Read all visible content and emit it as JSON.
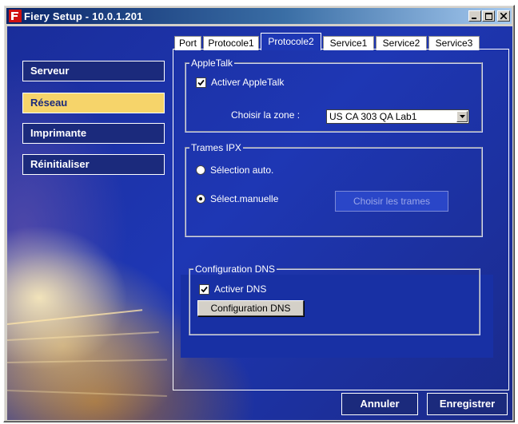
{
  "window": {
    "title": "Fiery Setup - 10.0.1.201",
    "icon": "fiery-app-icon",
    "controls": [
      "minimize-icon",
      "maximize-icon",
      "close-icon"
    ]
  },
  "sidebar": {
    "items": [
      {
        "label": "Serveur",
        "active": false
      },
      {
        "label": "Réseau",
        "active": true
      },
      {
        "label": "Imprimante",
        "active": false
      },
      {
        "label": "Réinitialiser",
        "active": false
      }
    ]
  },
  "tabs": [
    {
      "label": "Port"
    },
    {
      "label": "Protocole1"
    },
    {
      "label": "Protocole2",
      "active": true
    },
    {
      "label": "Service1"
    },
    {
      "label": "Service2"
    },
    {
      "label": "Service3"
    }
  ],
  "appletalk": {
    "legend": "AppleTalk",
    "enable_label": "Activer AppleTalk",
    "enable_checked": true,
    "zone_label": "Choisir la zone :",
    "zone_value": "US CA 303 QA Lab1"
  },
  "ipx": {
    "legend": "Trames IPX",
    "auto_label": "Sélection auto.",
    "manual_label": "Sélect.manuelle",
    "selected": "manual",
    "choose_frames_label": "Choisir les trames"
  },
  "dns": {
    "legend": "Configuration DNS",
    "enable_label": "Activer DNS",
    "enable_checked": true,
    "config_button_label": "Configuration DNS"
  },
  "actions": {
    "cancel_label": "Annuler",
    "save_label": "Enregistrer"
  },
  "colors": {
    "background_blue": "#1e37b4",
    "nav_active": "#f6d46a",
    "nav_inactive": "#1b2a7c",
    "titlebar": "#0a246a"
  }
}
